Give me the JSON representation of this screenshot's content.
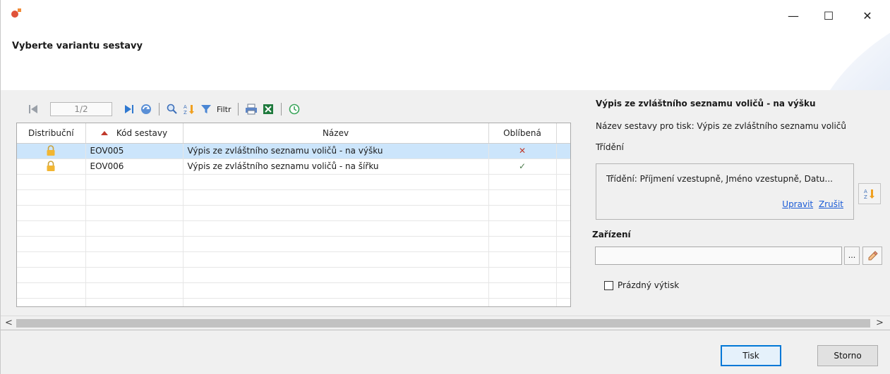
{
  "window": {
    "minimize": "—",
    "maximize": "☐",
    "close": "✕"
  },
  "header": {
    "title": "Vyberte variantu sestavy"
  },
  "toolbar": {
    "page_indicator": "1/2",
    "filter_label": "Filtr"
  },
  "grid": {
    "columns": [
      "Distribuční",
      "Kód sestavy",
      "Název",
      "Oblíbená"
    ],
    "rows": [
      {
        "code": "EOV005",
        "name": "Výpis ze zvláštního seznamu voličů - na výšku",
        "favorite": "✕"
      },
      {
        "code": "EOV006",
        "name": "Výpis ze zvláštního seznamu voličů - na šířku",
        "favorite": "✓"
      }
    ]
  },
  "right_panel": {
    "title": "Výpis ze zvláštního seznamu voličů - na výšku",
    "print_name": "Název sestavy pro tisk: Výpis ze zvláštního seznamu voličů",
    "sort_label": "Třídění",
    "sort_text": "Třídění: Příjmení vzestupně, Jméno vzestupně, Datu...",
    "edit_link": "Upravit",
    "cancel_link": "Zrušit",
    "device_label": "Zařízení",
    "device_value": "",
    "browse_label": "...",
    "empty_print_label": "Prázdný výtisk"
  },
  "scrollbar": {
    "left": "<",
    "right": ">"
  },
  "footer": {
    "print_button": "Tisk",
    "cancel_button": "Storno"
  },
  "colors": {
    "selected_row": "#cce5fb",
    "link": "#1a5bd6",
    "accent": "#0078d7",
    "cancel_mark": "#c0392b",
    "check_mark": "#4a7a4a"
  }
}
